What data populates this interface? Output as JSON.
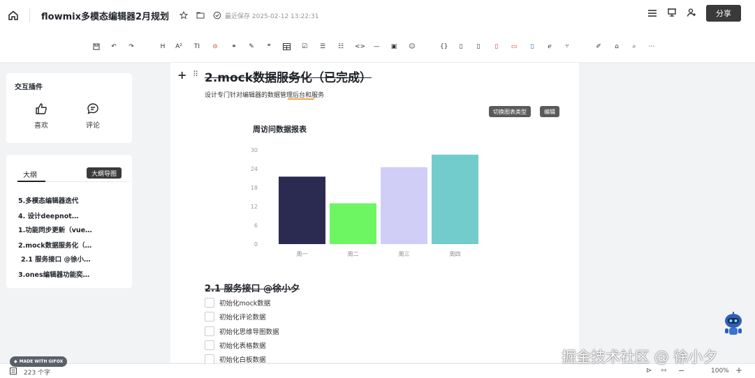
{
  "header": {
    "title": "flowmix多模态编辑器2月规划",
    "save_status": "最近保存 2025-02-12 13:22:31",
    "share_label": "分享"
  },
  "toolbar": {
    "items": [
      "H",
      "A²",
      "TI",
      "{}",
      "Ⓐ"
    ]
  },
  "plugins": {
    "title": "交互插件",
    "like_label": "喜欢",
    "comment_label": "评论"
  },
  "outline": {
    "tab_label": "大纲",
    "map_button": "大纲导图",
    "items": [
      "5.多模态编辑器迭代",
      "4. 设计deepnot…",
      "1.功能同步更新（vue…",
      "2.mock数据服务化（…",
      "2.1 服务接口 @徐小…",
      "3.ones编辑器功能奕…"
    ]
  },
  "editor": {
    "heading": "2.mock数据服务化（已完成）",
    "description": "设计专门针对编辑器的数据管理后台和服务",
    "switch_chart_label": "切换图表类型",
    "edit_label": "编辑",
    "subheading": "2.1 服务接口 @徐小夕",
    "tasks": [
      "初始化mock数据",
      "初始化评论数据",
      "初始化思维导图数据",
      "初始化表格数据",
      "初始化白板数据"
    ]
  },
  "chart_data": {
    "type": "bar",
    "title": "周访问数据报表",
    "categories": [
      "周一",
      "周二",
      "周三",
      "周四"
    ],
    "values": [
      21.5,
      13,
      24.5,
      28.5
    ],
    "colors": [
      "#2b2b52",
      "#6ef562",
      "#d0cdf7",
      "#72cccc"
    ],
    "yticks": [
      0,
      6,
      12,
      18,
      24,
      30
    ],
    "ylim": [
      0,
      30
    ]
  },
  "status": {
    "word_count": "223 个字",
    "zoom": "100%"
  },
  "watermark": "掘金技术社区 @ 徐小夕",
  "badge": "MADE WITH GIFOX"
}
